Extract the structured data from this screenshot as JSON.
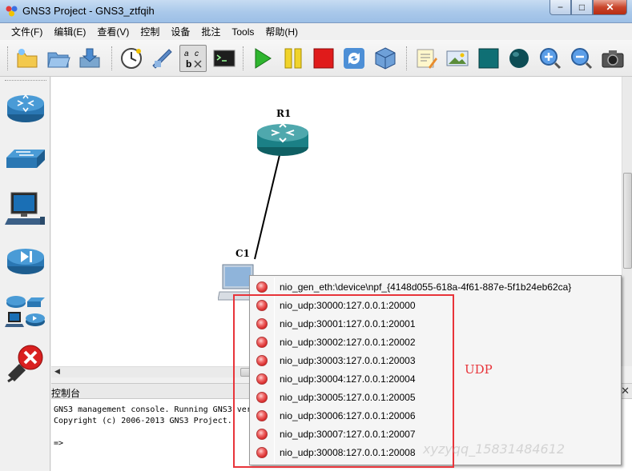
{
  "window": {
    "title": "GNS3 Project - GNS3_ztfqih",
    "min_label": "−",
    "max_label": "□",
    "close_label": "✕"
  },
  "menu": [
    {
      "label": "文件(F)"
    },
    {
      "label": "编辑(E)"
    },
    {
      "label": "查看(V)"
    },
    {
      "label": "控制"
    },
    {
      "label": "设备"
    },
    {
      "label": "批注"
    },
    {
      "label": "Tools"
    },
    {
      "label": "帮助(H)"
    }
  ],
  "toolbar": {
    "buttons": [
      {
        "icon": "new-project-icon"
      },
      {
        "icon": "open-project-icon"
      },
      {
        "icon": "save-project-icon"
      },
      {
        "icon": "snapshot-clock-icon"
      },
      {
        "icon": "show-interface-labels-icon"
      },
      {
        "icon": "add-link-icon"
      },
      {
        "icon": "console-icon"
      },
      {
        "icon": "start-icon"
      },
      {
        "icon": "suspend-icon"
      },
      {
        "icon": "stop-icon"
      },
      {
        "icon": "reload-icon"
      },
      {
        "icon": "virtualbox-icon"
      },
      {
        "icon": "add-note-icon"
      },
      {
        "icon": "insert-picture-icon"
      },
      {
        "icon": "draw-rectangle-icon"
      },
      {
        "icon": "draw-ellipse-icon"
      },
      {
        "icon": "zoom-in-icon"
      },
      {
        "icon": "zoom-out-icon"
      },
      {
        "icon": "screenshot-camera-icon"
      }
    ]
  },
  "devices": [
    {
      "icon": "router-icon"
    },
    {
      "icon": "switch-icon"
    },
    {
      "icon": "end-device-icon"
    },
    {
      "icon": "security-device-icon"
    },
    {
      "icon": "all-devices-icon"
    },
    {
      "icon": "add-link-icon"
    }
  ],
  "topology": {
    "nodes": [
      {
        "label": "R1",
        "type": "router"
      },
      {
        "label": "C1",
        "type": "cloud-host"
      }
    ]
  },
  "console": {
    "title": "控制台",
    "close_label": "✕",
    "lines": [
      "GNS3 management console. Running GNS3 ver",
      "Copyright (c) 2006-2013 GNS3 Project.",
      "",
      "=>"
    ]
  },
  "context_menu": {
    "items": [
      {
        "label": "nio_gen_eth:\\device\\npf_{4148d055-618a-4f61-887e-5f1b24eb62ca}"
      },
      {
        "label": "nio_udp:30000:127.0.0.1:20000"
      },
      {
        "label": "nio_udp:30001:127.0.0.1:20001"
      },
      {
        "label": "nio_udp:30002:127.0.0.1:20002"
      },
      {
        "label": "nio_udp:30003:127.0.0.1:20003"
      },
      {
        "label": "nio_udp:30004:127.0.0.1:20004"
      },
      {
        "label": "nio_udp:30005:127.0.0.1:20005"
      },
      {
        "label": "nio_udp:30006:127.0.0.1:20006"
      },
      {
        "label": "nio_udp:30007:127.0.0.1:20007"
      },
      {
        "label": "nio_udp:30008:127.0.0.1:20008"
      }
    ]
  },
  "annotation": {
    "label": "UDP",
    "color": "#e8343a"
  },
  "watermark": "xyzyqq_15831484612"
}
